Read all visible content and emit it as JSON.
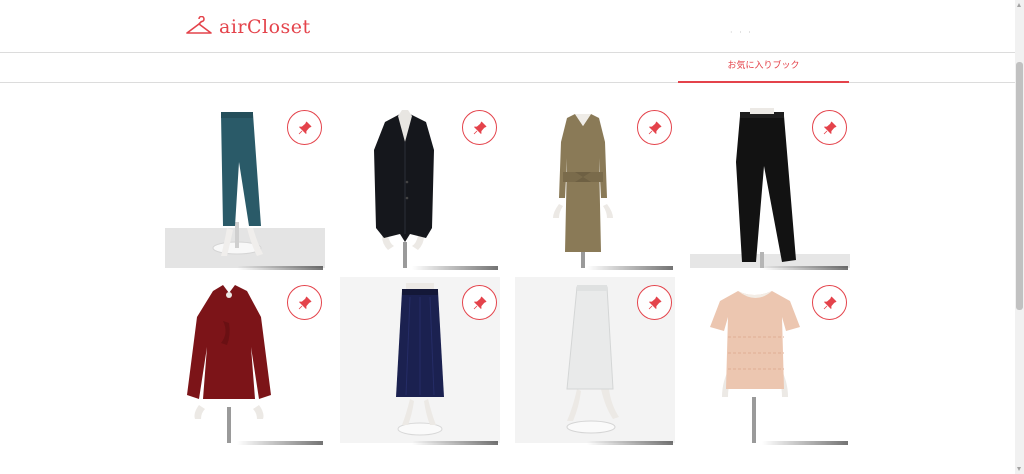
{
  "brand": {
    "name": "airCloset",
    "accent_color": "#e4434b"
  },
  "header": {
    "dots": "· · ·"
  },
  "tabs": [
    {
      "label": "お気に入りブック",
      "active": true
    }
  ],
  "favorite_icon": "pin-icon",
  "items": [
    {
      "name": "teal-cropped-pants",
      "garment": "pants",
      "color": "#2a5a68"
    },
    {
      "name": "black-tailored-jacket",
      "garment": "jacket",
      "color": "#15171c"
    },
    {
      "name": "check-belted-dress",
      "garment": "dress",
      "color": "#8a7a57"
    },
    {
      "name": "black-tapered-pants",
      "garment": "pants",
      "color": "#121212"
    },
    {
      "name": "burgundy-blouse",
      "garment": "blouse",
      "color": "#7c1418"
    },
    {
      "name": "navy-pleated-skirt",
      "garment": "skirt",
      "color": "#1b2150"
    },
    {
      "name": "white-skirt",
      "garment": "skirt-straight",
      "color": "#e9eaea"
    },
    {
      "name": "beige-lace-top",
      "garment": "lace-top",
      "color": "#ecc6b0"
    }
  ]
}
